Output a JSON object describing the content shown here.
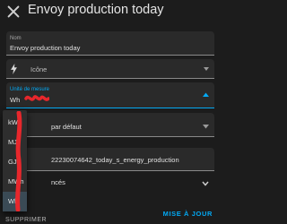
{
  "dialog": {
    "title": "Envoy production today",
    "update_label": "MISE À JOUR",
    "delete_label": "SUPPRIMER"
  },
  "fields": {
    "name": {
      "label": "Nom",
      "value": "Envoy production today"
    },
    "icon": {
      "value": "Icône",
      "icon": "lightning-bolt-icon"
    },
    "unit": {
      "label": "Unité de mesure",
      "value": "Wh"
    },
    "display": {
      "value": "par défaut"
    },
    "entity": {
      "value": "22230074642_today_s_energy_production"
    },
    "advanced": {
      "label": "ncés"
    }
  },
  "unit_menu": {
    "options": [
      "kWh",
      "MJ",
      "GJ",
      "MWh",
      "Wh"
    ],
    "selected": "Wh"
  },
  "colors": {
    "accent": "#03a9f4",
    "background": "#1c1c1c",
    "field_bg": "#2a2a2a",
    "annotation": "#e8272c"
  }
}
